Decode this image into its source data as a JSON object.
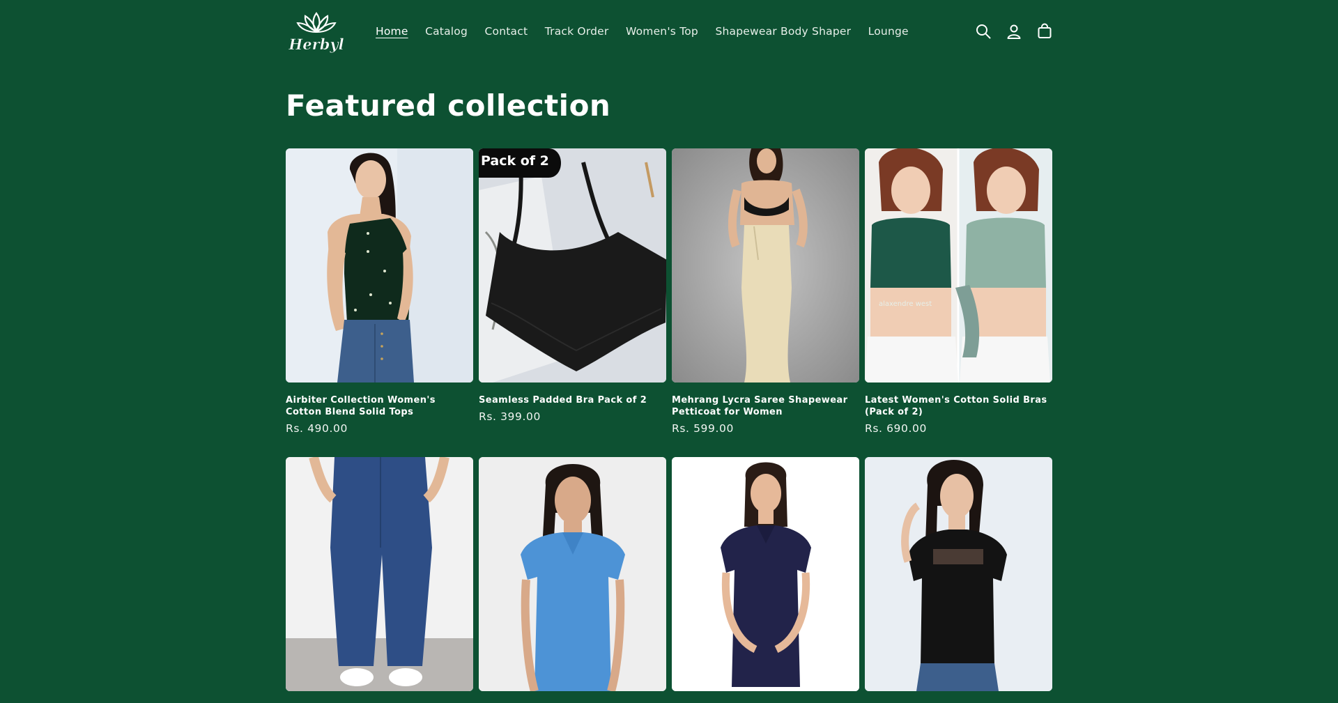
{
  "header": {
    "logo_text": "Herbyl",
    "nav": [
      {
        "label": "Home",
        "active": true
      },
      {
        "label": "Catalog",
        "active": false
      },
      {
        "label": "Contact",
        "active": false
      },
      {
        "label": "Track Order",
        "active": false
      },
      {
        "label": "Women's Top",
        "active": false
      },
      {
        "label": "Shapewear Body Shaper",
        "active": false
      },
      {
        "label": "Lounge",
        "active": false
      }
    ],
    "icons": [
      "search-icon",
      "account-icon",
      "cart-icon"
    ]
  },
  "section": {
    "title": "Featured collection"
  },
  "products": [
    {
      "title": "Airbiter Collection Women's Cotton Blend Solid Tops",
      "price": "Rs. 490.00"
    },
    {
      "title": "Seamless Padded Bra Pack of 2",
      "price": "Rs. 399.00",
      "badge": "Pack of 2"
    },
    {
      "title": "Mehrang Lycra Saree Shapewear Petticoat for Women",
      "price": "Rs. 599.00"
    },
    {
      "title": "Latest Women's Cotton Solid Bras (Pack of 2)",
      "price": "Rs. 690.00",
      "print_text": "alaxendre west"
    },
    {
      "title": "",
      "price": ""
    },
    {
      "title": "",
      "price": ""
    },
    {
      "title": "",
      "price": ""
    },
    {
      "title": "",
      "price": ""
    }
  ],
  "colors": {
    "background": "#0d5132",
    "text": "#ffffff"
  }
}
